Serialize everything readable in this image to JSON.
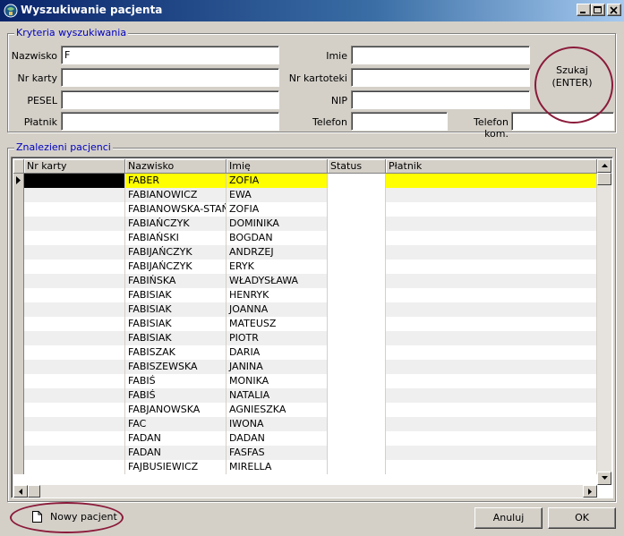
{
  "window": {
    "title": "Wyszukiwanie pacjenta"
  },
  "criteria": {
    "legend": "Kryteria wyszukiwania",
    "surname_label": "Nazwisko",
    "surname_value": "F",
    "card_label": "Nr karty",
    "pesel_label": "PESEL",
    "payer_label": "Płatnik",
    "name_label": "Imie",
    "file_label": "Nr kartoteki",
    "nip_label": "NIP",
    "phone_label": "Telefon",
    "mobile_label": "Telefon kom.",
    "search_line1": "Szukaj",
    "search_line2": "(ENTER)"
  },
  "results": {
    "legend": "Znalezieni pacjenci",
    "columns": [
      "Nr karty",
      "Nazwisko",
      "Imię",
      "Status",
      "Płatnik"
    ],
    "rows": [
      [
        "",
        "FABER",
        "ZOFIA",
        "",
        ""
      ],
      [
        "",
        "FABIANOWICZ",
        "EWA",
        "",
        ""
      ],
      [
        "",
        "FABIANOWSKA-STAŃ",
        "ZOFIA",
        "",
        ""
      ],
      [
        "",
        "FABIAŃCZYK",
        "DOMINIKA",
        "",
        ""
      ],
      [
        "",
        "FABIAŃSKI",
        "BOGDAN",
        "",
        ""
      ],
      [
        "",
        "FABIJAŃCZYK",
        "ANDRZEJ",
        "",
        ""
      ],
      [
        "",
        "FABIJAŃCZYK",
        "ERYK",
        "",
        ""
      ],
      [
        "",
        "FABIŃSKA",
        "WŁADYSŁAWA",
        "",
        ""
      ],
      [
        "",
        "FABISIAK",
        "HENRYK",
        "",
        ""
      ],
      [
        "",
        "FABISIAK",
        "JOANNA",
        "",
        ""
      ],
      [
        "",
        "FABISIAK",
        "MATEUSZ",
        "",
        ""
      ],
      [
        "",
        "FABISIAK",
        "PIOTR",
        "",
        ""
      ],
      [
        "",
        "FABISZAK",
        "DARIA",
        "",
        ""
      ],
      [
        "",
        "FABISZEWSKA",
        "JANINA",
        "",
        ""
      ],
      [
        "",
        "FABIŚ",
        "MONIKA",
        "",
        ""
      ],
      [
        "",
        "FABIŚ",
        "NATALIA",
        "",
        ""
      ],
      [
        "",
        "FABJANOWSKA",
        "AGNIESZKA",
        "",
        ""
      ],
      [
        "",
        "FAC",
        "IWONA",
        "",
        ""
      ],
      [
        "",
        "FADAN",
        "DADAN",
        "",
        ""
      ],
      [
        "",
        "FADAN",
        "FASFAS",
        "",
        ""
      ],
      [
        "",
        "FAJBUSIEWICZ",
        "MIRELLA",
        "",
        ""
      ]
    ]
  },
  "footer": {
    "new_patient": "Nowy pacjent",
    "cancel": "Anuluj",
    "ok": "OK"
  },
  "colors": {
    "selected_row": "#ffff00",
    "annotation_circle": "#8b1a3a",
    "legend_text": "#0000c0"
  }
}
